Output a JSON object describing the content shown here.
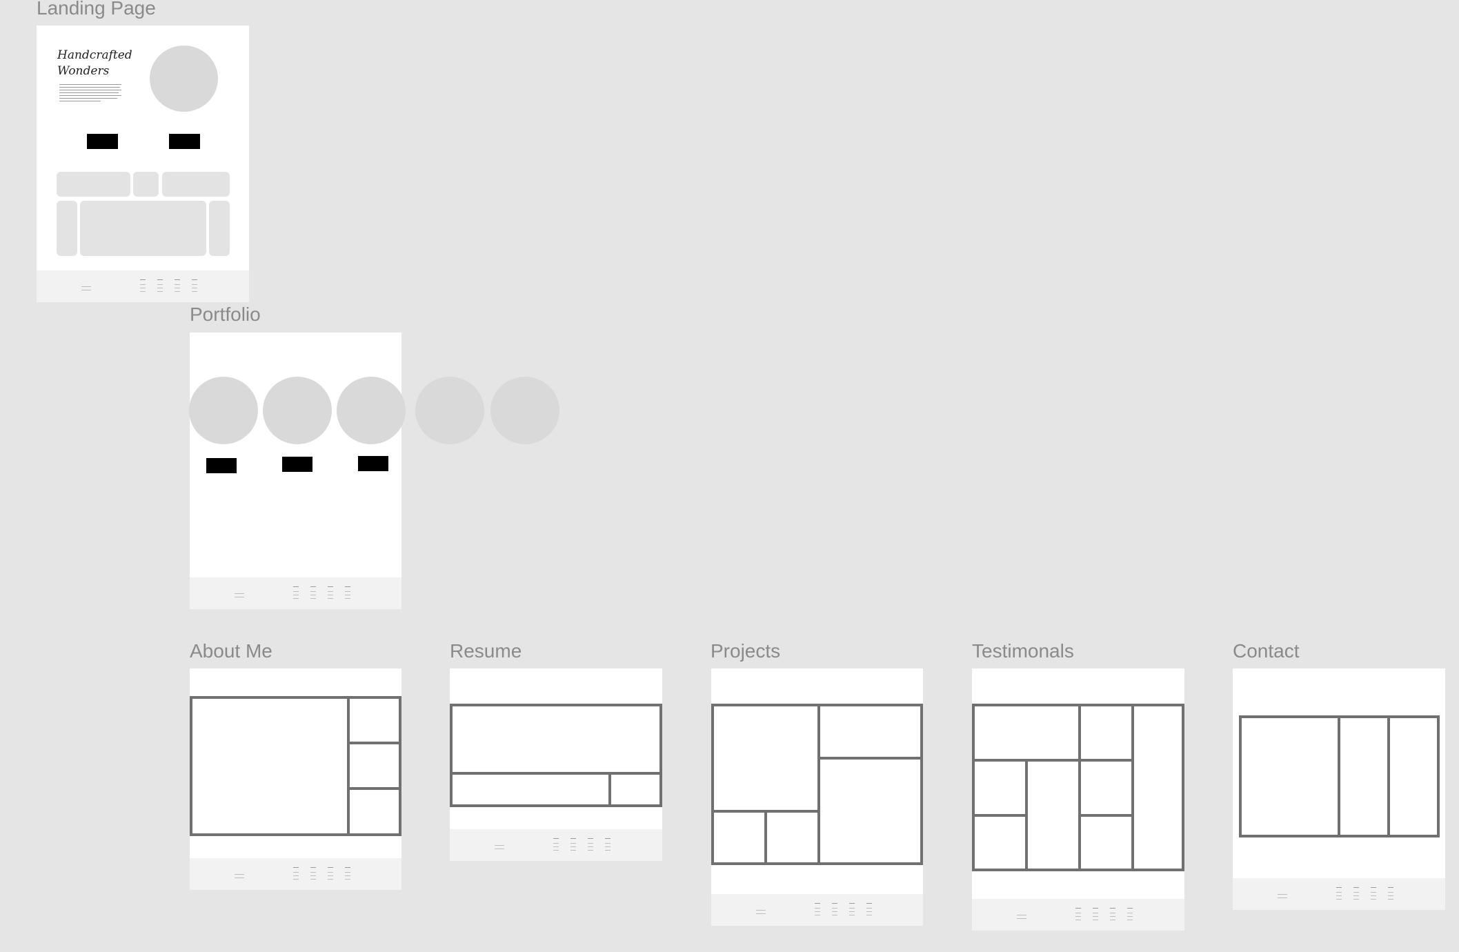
{
  "frames": {
    "landing": {
      "label": "Landing Page",
      "hero_title_line1": "Handcrafted",
      "hero_title_line2": "Wonders"
    },
    "portfolio": {
      "label": "Portfolio"
    },
    "about": {
      "label": "About Me"
    },
    "resume": {
      "label": "Resume"
    },
    "projects": {
      "label": "Projects"
    },
    "testimonials": {
      "label": "Testimonals"
    },
    "contact": {
      "label": "Contact"
    }
  },
  "colors": {
    "canvas": "#e5e5e5",
    "frame": "#ffffff",
    "placeholder": "#d9d9d9",
    "tile": "#e3e3e3",
    "button": "#000000",
    "border": "#707070",
    "footer": "#f2f2f2",
    "label": "#8a8a8a"
  }
}
